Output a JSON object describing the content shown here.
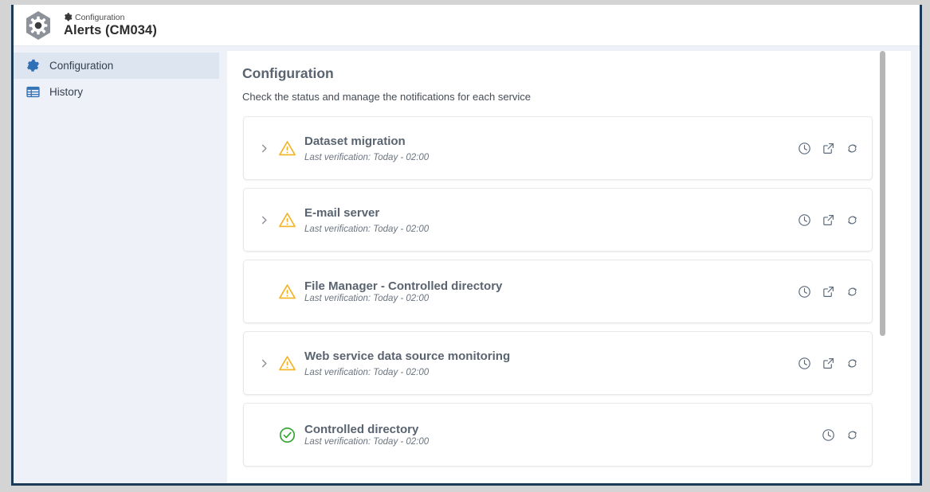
{
  "header": {
    "breadcrumb": "Configuration",
    "breadcrumb_icon": "gear-icon",
    "title": "Alerts (CM034)",
    "logo_icon": "hexagon-gear-logo-icon"
  },
  "sidebar": {
    "items": [
      {
        "label": "Configuration",
        "icon": "gear-icon",
        "selected": true
      },
      {
        "label": "History",
        "icon": "table-grid-icon",
        "selected": false
      }
    ]
  },
  "main": {
    "title": "Configuration",
    "subtitle": "Check the status and manage the notifications for each service",
    "cards": [
      {
        "title": "Dataset migration",
        "subtitle": "Last verification: Today - 02:00",
        "status": "warning",
        "status_icon": "warning-triangle-icon",
        "expandable": true,
        "chevron_icon": "chevron-right-icon",
        "spacing": "loose",
        "actions": [
          "clock-icon",
          "external-link-icon",
          "refresh-icon"
        ]
      },
      {
        "title": "E-mail server",
        "subtitle": "Last verification: Today - 02:00",
        "status": "warning",
        "status_icon": "warning-triangle-icon",
        "expandable": true,
        "chevron_icon": "chevron-right-icon",
        "spacing": "loose",
        "actions": [
          "clock-icon",
          "external-link-icon",
          "refresh-icon"
        ]
      },
      {
        "title": "File Manager - Controlled directory",
        "subtitle": "Last verification: Today - 02:00",
        "status": "warning",
        "status_icon": "warning-triangle-icon",
        "expandable": false,
        "chevron_icon": "",
        "spacing": "tight",
        "actions": [
          "clock-icon",
          "external-link-icon",
          "refresh-icon"
        ]
      },
      {
        "title": "Web service data source monitoring",
        "subtitle": "Last verification: Today - 02:00",
        "status": "warning",
        "status_icon": "warning-triangle-icon",
        "expandable": true,
        "chevron_icon": "chevron-right-icon",
        "spacing": "loose",
        "actions": [
          "clock-icon",
          "external-link-icon",
          "refresh-icon"
        ]
      },
      {
        "title": "Controlled directory",
        "subtitle": "Last verification: Today - 02:00",
        "status": "ok",
        "status_icon": "check-circle-icon",
        "expandable": false,
        "chevron_icon": "",
        "spacing": "tight",
        "actions": [
          "clock-icon",
          "refresh-icon"
        ]
      }
    ]
  },
  "scrollbar": {
    "orientation": "vertical",
    "thumb_position_pct": 0
  },
  "colors": {
    "warning": "#f4b323",
    "ok": "#2fa32f",
    "accent": "#2f6fb5",
    "window_border": "#1b3a57",
    "sidebar_bg": "#eef1f7",
    "sidebar_selected": "#dde5f1",
    "title_text": "#5a6470",
    "icon_stroke": "#5b6a7d"
  }
}
